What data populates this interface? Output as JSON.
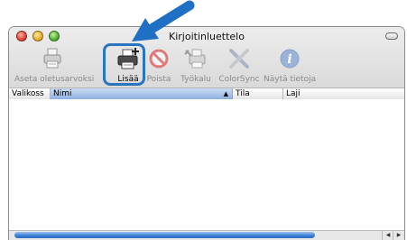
{
  "window": {
    "title": "Kirjoitinluettelo"
  },
  "toolbar": {
    "items": [
      {
        "label": "Aseta oletusarvoksi",
        "icon": "printer-default-icon",
        "enabled": false
      },
      {
        "label": "Lisää",
        "icon": "add-printer-icon",
        "enabled": true
      },
      {
        "label": "Poista",
        "icon": "delete-icon",
        "enabled": false
      },
      {
        "label": "Työkalu",
        "icon": "utility-icon",
        "enabled": false
      },
      {
        "label": "ColorSync",
        "icon": "colorsync-icon",
        "enabled": false
      },
      {
        "label": "Näytä tietoja",
        "icon": "info-icon",
        "enabled": false
      }
    ]
  },
  "columns": [
    {
      "label": "Valikoss"
    },
    {
      "label": "Nimi",
      "sorted": true
    },
    {
      "label": "Tila"
    },
    {
      "label": "Laji"
    }
  ],
  "highlight_color": "#2a75c0",
  "annotation": {
    "icon": "pointer-arrow-icon"
  }
}
